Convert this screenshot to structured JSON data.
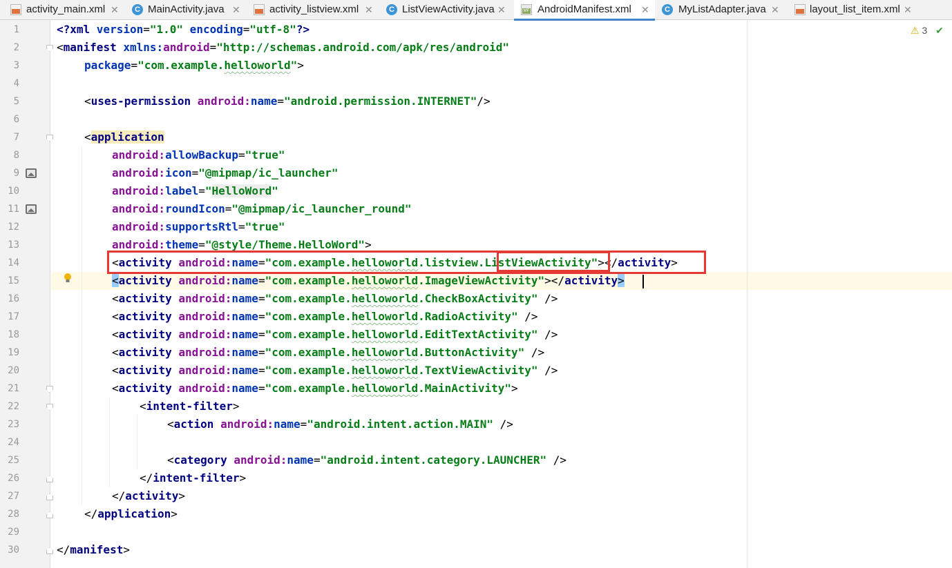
{
  "tabs": [
    {
      "label": "activity_main.xml",
      "icon": "xml-file-icon",
      "active": false
    },
    {
      "label": "MainActivity.java",
      "icon": "java-class-icon",
      "active": false
    },
    {
      "label": "activity_listview.xml",
      "icon": "xml-file-icon",
      "active": false
    },
    {
      "label": "ListViewActivity.java",
      "icon": "java-class-icon",
      "active": false
    },
    {
      "label": "AndroidManifest.xml",
      "icon": "manifest-file-icon",
      "active": true
    },
    {
      "label": "MyListAdapter.java",
      "icon": "java-class-icon",
      "active": false
    },
    {
      "label": "layout_list_item.xml",
      "icon": "xml-file-icon",
      "active": false
    }
  ],
  "tab_close_glyph": "✕",
  "inspection": {
    "warnings": "3",
    "icon": "warning-icon",
    "ok_icon": "check-icon"
  },
  "line_numbers": [
    "1",
    "2",
    "3",
    "4",
    "5",
    "6",
    "7",
    "8",
    "9",
    "10",
    "11",
    "12",
    "13",
    "14",
    "15",
    "16",
    "17",
    "18",
    "19",
    "20",
    "21",
    "22",
    "23",
    "24",
    "25",
    "26",
    "27",
    "28",
    "29",
    "30"
  ],
  "code": {
    "l1": [
      "<?",
      "xml ",
      "version",
      "=",
      "\"1.0\"",
      " encoding",
      "=",
      "\"utf-8\"",
      "?>"
    ],
    "l2": [
      "<",
      "manifest ",
      "xmlns:",
      "android",
      "=",
      "\"http://schemas.android.com/apk/res/android\""
    ],
    "l3": [
      "package",
      "=",
      "\"com.example.",
      "helloworld",
      "\"",
      ">"
    ],
    "l5": [
      "<",
      "uses-permission ",
      "android:",
      "name",
      "=",
      "\"android.permission.INTERNET\"",
      "/>"
    ],
    "l7": [
      "<",
      "application"
    ],
    "l8": [
      "android:",
      "allowBackup",
      "=",
      "\"true\""
    ],
    "l9": [
      "android:",
      "icon",
      "=",
      "\"@mipmap/ic_launcher\""
    ],
    "l10": [
      "android:",
      "label",
      "=",
      "\"",
      "HelloWord",
      "\""
    ],
    "l11": [
      "android:",
      "roundIcon",
      "=",
      "\"@mipmap/ic_launcher_round\""
    ],
    "l12": [
      "android:",
      "supportsRtl",
      "=",
      "\"true\""
    ],
    "l13": [
      "android:",
      "theme",
      "=",
      "\"@style/Theme.HelloWord\"",
      ">"
    ],
    "l14": [
      "<",
      "activity ",
      "android:",
      "name",
      "=",
      "\"com.example.",
      "helloworld",
      ".listview.",
      "ListViewActivity",
      "\"",
      "></",
      "activity",
      ">"
    ],
    "l15": [
      "<",
      "activity ",
      "android:",
      "name",
      "=",
      "\"com.example.",
      "helloworld",
      ".ImageViewActivity\"",
      "></",
      "activity",
      ">"
    ],
    "l16": [
      "<",
      "activity ",
      "android:",
      "name",
      "=",
      "\"com.example.",
      "helloworld",
      ".CheckBoxActivity\"",
      " />"
    ],
    "l17": [
      "<",
      "activity ",
      "android:",
      "name",
      "=",
      "\"com.example.",
      "helloworld",
      ".RadioActivity\"",
      " />"
    ],
    "l18": [
      "<",
      "activity ",
      "android:",
      "name",
      "=",
      "\"com.example.",
      "helloworld",
      ".EditTextActivity\"",
      " />"
    ],
    "l19": [
      "<",
      "activity ",
      "android:",
      "name",
      "=",
      "\"com.example.",
      "helloworld",
      ".ButtonActivity\"",
      " />"
    ],
    "l20": [
      "<",
      "activity ",
      "android:",
      "name",
      "=",
      "\"com.example.",
      "helloworld",
      ".TextViewActivity\"",
      " />"
    ],
    "l21": [
      "<",
      "activity ",
      "android:",
      "name",
      "=",
      "\"com.example.",
      "helloworld",
      ".MainActivity\"",
      ">"
    ],
    "l22": [
      "<",
      "intent-filter",
      ">"
    ],
    "l23": [
      "<",
      "action ",
      "android:",
      "name",
      "=",
      "\"android.intent.action.MAIN\"",
      " />"
    ],
    "l25": [
      "<",
      "category ",
      "android:",
      "name",
      "=",
      "\"android.intent.category.LAUNCHER\"",
      " />"
    ],
    "l26": [
      "</",
      "intent-filter",
      ">"
    ],
    "l27": [
      "</",
      "activity",
      ">"
    ],
    "l28": [
      "</",
      "application",
      ">"
    ],
    "l30": [
      "</",
      "manifest",
      ">"
    ]
  },
  "colors": {
    "tag": "#000080",
    "namespace": "#871094",
    "attribute": "#0033b3",
    "value": "#067d17",
    "highlight_box": "#e53935",
    "active_tab_underline": "#4083c9"
  }
}
